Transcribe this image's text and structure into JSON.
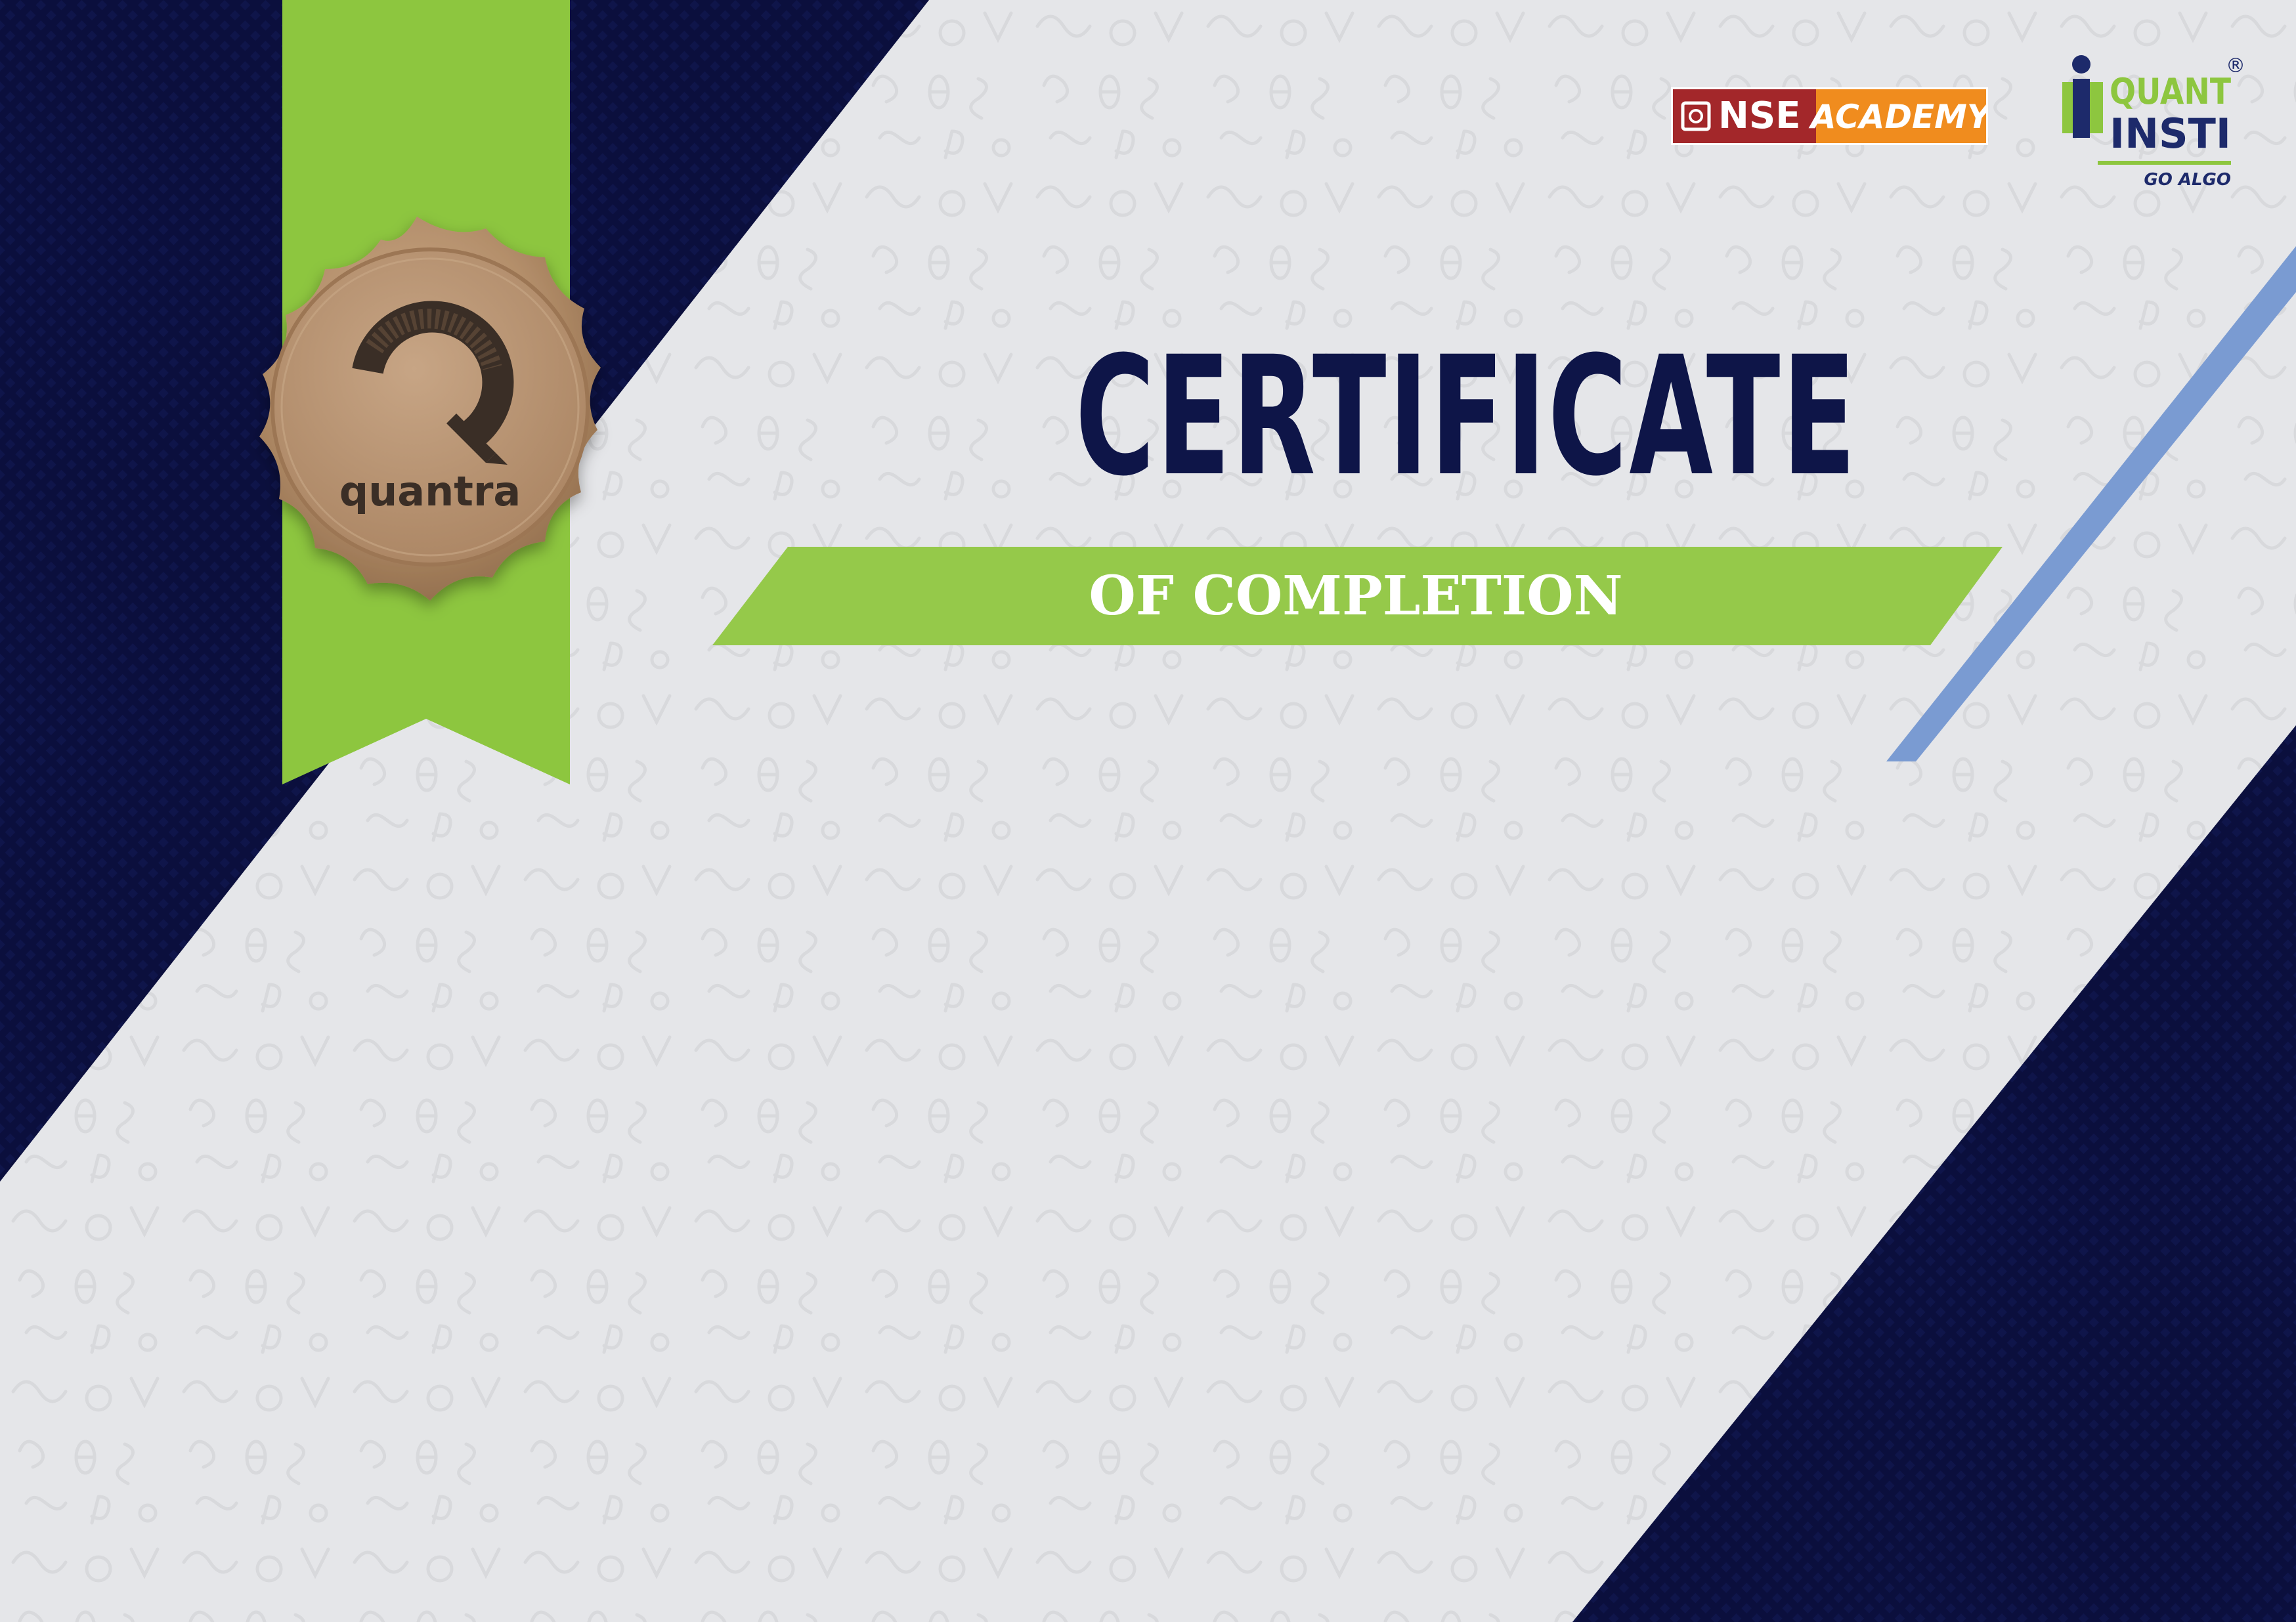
{
  "certificate": {
    "title": "CERTIFICATE",
    "subtitle": "OF COMPLETION"
  },
  "logos": {
    "nse_left": "NSE",
    "nse_right": "ACADEMY",
    "quantinsti_line1": "QUANT",
    "quantinsti_line2": "INSTI",
    "quantinsti_tagline": "GO ALGO",
    "registered_mark": "®"
  },
  "medal": {
    "brand": "quantra",
    "ring_text": "QUANTRA"
  },
  "colors": {
    "navy": "#0b0f3d",
    "navy_dark": "#060a2a",
    "ribbon_green": "#8dc63f",
    "banner_green": "#95c94a",
    "accent_blue": "#7a9bd2",
    "paper": "#e5e6e9",
    "medal_bronze": "#b4906c",
    "nse_red": "#a3272a",
    "nse_orange": "#f08c1e",
    "quantinsti_green": "#8dc63f",
    "quantinsti_navy": "#1d2a6b"
  }
}
